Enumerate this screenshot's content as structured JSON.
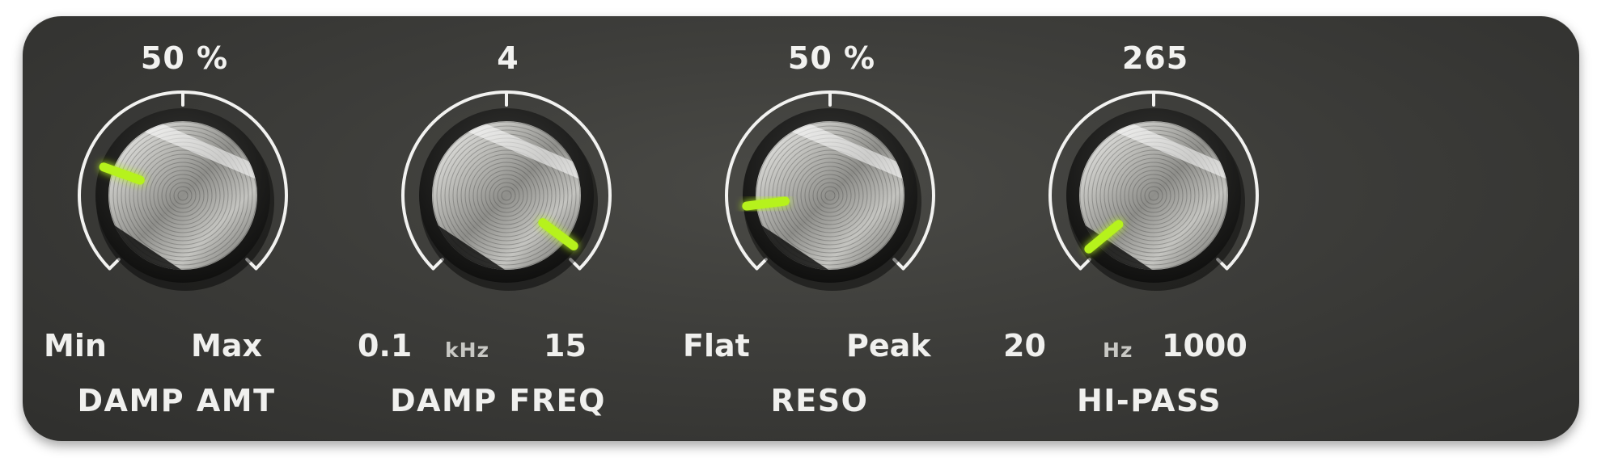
{
  "knobs": [
    {
      "name": "DAMP AMT",
      "value_text": "50 %",
      "min_label": "Min",
      "max_label": "Max",
      "unit": "",
      "position": 0.24,
      "led_color": "#b6f21a"
    },
    {
      "name": "DAMP FREQ",
      "value_text": "4",
      "min_label": "0.1",
      "max_label": "15",
      "unit": "kHz",
      "position": 0.97,
      "led_color": "#b6f21a"
    },
    {
      "name": "RESO",
      "value_text": "50 %",
      "min_label": "Flat",
      "max_label": "Peak",
      "unit": "",
      "position": 0.14,
      "led_color": "#b6f21a"
    },
    {
      "name": "HI-PASS",
      "value_text": "265",
      "min_label": "20",
      "max_label": "1000",
      "unit": "Hz",
      "position": 0.02,
      "led_color": "#b6f21a"
    }
  ],
  "colors": {
    "panel": "#3d3d3a",
    "scale": "#f2f2f0",
    "led": "#b6f21a"
  }
}
